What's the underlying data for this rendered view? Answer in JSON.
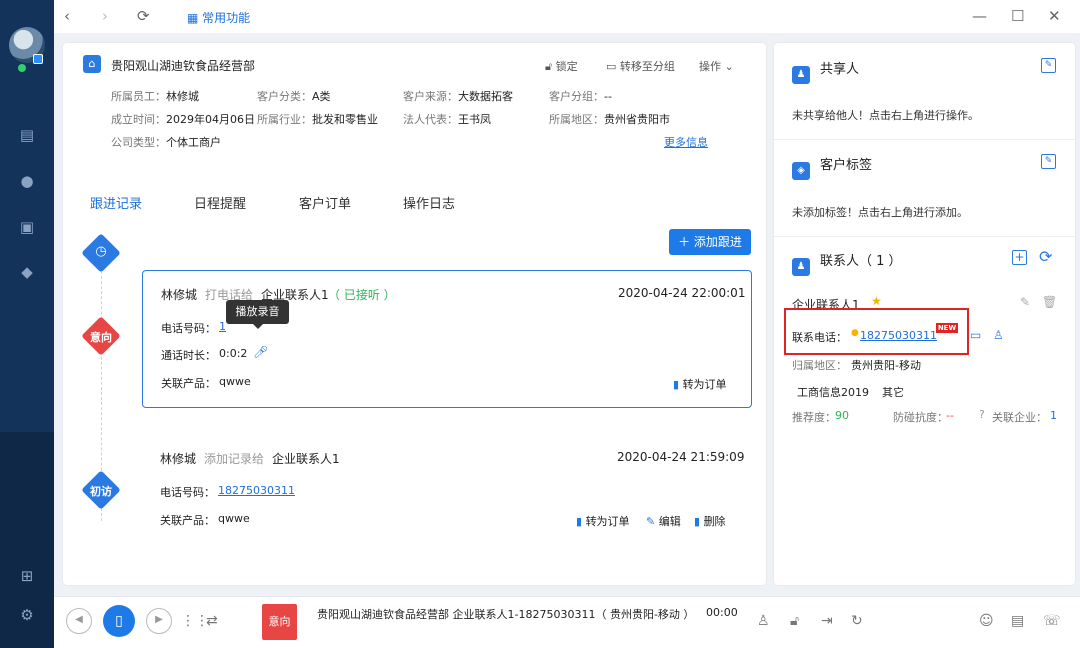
{
  "topbar": {
    "back": "‹",
    "forward": "›",
    "refresh": "⟳",
    "favorites_label": "常用功能",
    "minimize": "—",
    "maximize": "☐",
    "close": "✕"
  },
  "company": {
    "name": "贵阳观山湖迪钦食品经营部",
    "actions": {
      "lock": "锁定",
      "move_group": "转移至分组",
      "operate": "操作"
    },
    "fields": [
      {
        "label": "所属员工：",
        "value": "林修城"
      },
      {
        "label": "客户分类：",
        "value": "A类"
      },
      {
        "label": "客户来源：",
        "value": "大数据拓客"
      },
      {
        "label": "客户分组：",
        "value": "--"
      },
      {
        "label": "成立时间：",
        "value": "2029年04月06日"
      },
      {
        "label": "所属行业：",
        "value": "批发和零售业"
      },
      {
        "label": "法人代表：",
        "value": "王书凤"
      },
      {
        "label": "所属地区：",
        "value": "贵州省贵阳市"
      },
      {
        "label": "公司类型：",
        "value": "个体工商户"
      }
    ],
    "more_info": "更多信息"
  },
  "tabs": [
    "跟进记录",
    "日程提醒",
    "客户订单",
    "操作日志"
  ],
  "add_followup": "添加跟进",
  "records": [
    {
      "tag": "意向",
      "user": "林修城",
      "action": "打电话给",
      "target": "企业联系人1",
      "status": "（ 已接听 ）",
      "time": "2020-04-24 22:00:01",
      "phone_label": "电话号码：",
      "phone": "1",
      "duration_label": "通话时长：",
      "duration": "0:0:2",
      "product_label": "关联产品：",
      "product": "qwwe",
      "to_order": "转为订单",
      "tooltip": "播放录音"
    },
    {
      "tag": "初访",
      "user": "林修城",
      "action": "添加记录给",
      "target": "企业联系人1",
      "time": "2020-04-24 21:59:09",
      "phone_label": "电话号码：",
      "phone": "18275030311",
      "product_label": "关联产品：",
      "product": "qwwe",
      "to_order": "转为订单",
      "edit": "编辑",
      "delete": "删除"
    }
  ],
  "right": {
    "share_title": "共享人",
    "share_empty": "未共享给他人！点击右上角进行操作。",
    "tag_title": "客户标签",
    "tag_empty": "未添加标签！点击右上角进行添加。",
    "contact_title": "联系人（ 1 ）",
    "contact": {
      "name": "企业联系人1",
      "phone_label": "联系电话：",
      "phone": "18275030311",
      "new_badge": "NEW",
      "region_label": "归属地区：",
      "region": "贵州贵阳-移动",
      "info1": "工商信息2019",
      "info2": "其它",
      "recommend_label": "推荐度：",
      "recommend": "90",
      "collision_label": "防碰抗度：",
      "collision": "--",
      "related_label": "关联企业：",
      "related": "1"
    }
  },
  "bottom": {
    "intent": "意向",
    "call_info": "贵阳观山湖迪钦食品经营部   企业联系人1-18275030311（ 贵州贵阳-移动 ）",
    "timer": "00:00"
  },
  "colors": {
    "primary": "#1e7ae6",
    "sidebar": "#14335a",
    "intent": "#e84545",
    "first_visit": "#2a7ae2",
    "highlight_box": "#e02424"
  }
}
